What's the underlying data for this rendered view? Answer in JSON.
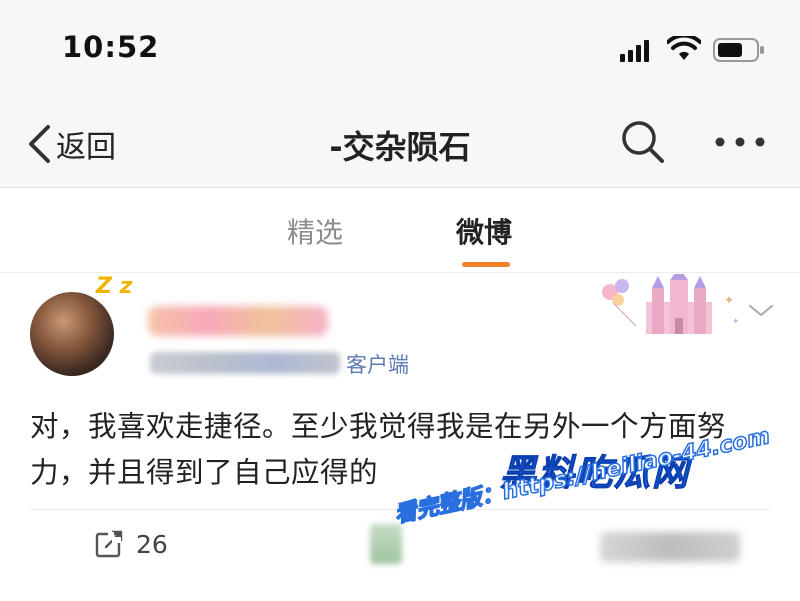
{
  "status_bar": {
    "time": "10:52",
    "icons": [
      "signal-icon",
      "wifi-icon",
      "battery-icon"
    ]
  },
  "nav": {
    "back_label": "返回",
    "title": "-交杂陨石",
    "icons": [
      "chevron-left-icon",
      "search-icon",
      "more-icon"
    ]
  },
  "tabs": [
    {
      "label": "精选",
      "active": false
    },
    {
      "label": "微博",
      "active": true
    }
  ],
  "colors": {
    "accent": "#f0822a",
    "link": "#5b7bb5",
    "inactive_tab": "#8d8d8d",
    "watermark_blue": "#1e6ef0"
  },
  "post": {
    "avatar_badge": "Z z",
    "source": "客户端",
    "text": "对，我喜欢走捷径。至少我觉得我是在另外一个方面努力，并且得到了自己应得的",
    "repost_count": "26"
  },
  "watermark": {
    "title": "黑料吃瓜网",
    "url_text": "看完整版：https://heiliao-44.com"
  }
}
